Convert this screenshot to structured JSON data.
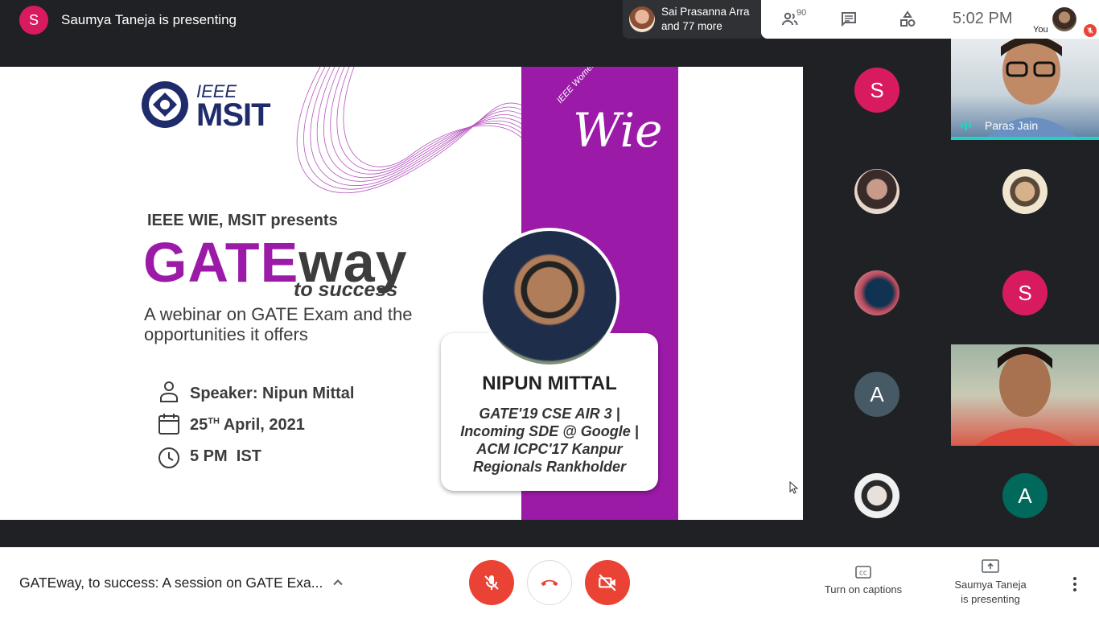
{
  "topbar": {
    "presenter_initial": "S",
    "presenting_text": "Saumya Taneja is presenting"
  },
  "join_notice": {
    "line1": "Sai Prasanna Arra",
    "line2": "and 77 more"
  },
  "info_bar": {
    "people_count": "90",
    "time": "5:02 PM",
    "you_label": "You"
  },
  "slide": {
    "logo_ieee": "IEEE",
    "logo_msit": "MSIT",
    "wie_small": "IEEE Women in Engineering",
    "wie_big": "Wie",
    "presents": "IEEE WIE, MSIT presents",
    "gate_part1": "GATE",
    "gate_part2": "way",
    "to_success": "to success",
    "webinar_text": "A webinar on GATE Exam and the opportunities it offers",
    "speaker_label": "Speaker: Nipun Mittal",
    "date_day": "25",
    "date_suffix": "TH",
    "date_rest": " April, 2021",
    "time": "5 PM  IST",
    "speaker_name": "NIPUN MITTAL",
    "speaker_desc": "GATE'19 CSE AIR 3 | Incoming SDE @ Google | ACM ICPC'17 Kanpur Regionals Rankholder"
  },
  "participants": [
    {
      "kind": "initial",
      "initial": "S",
      "color": "#d81b60"
    },
    {
      "kind": "video",
      "name": "Paras Jain",
      "speaking": true
    },
    {
      "kind": "photo",
      "color": "#c89a8a"
    },
    {
      "kind": "photo",
      "color": "#d6b28c"
    },
    {
      "kind": "photo",
      "color": "#b84a5c"
    },
    {
      "kind": "initial",
      "initial": "S",
      "color": "#d81b60"
    },
    {
      "kind": "initial",
      "initial": "A",
      "color": "#455a64"
    },
    {
      "kind": "video",
      "name": ""
    },
    {
      "kind": "photo",
      "color": "#8a8a8a"
    },
    {
      "kind": "initial",
      "initial": "A",
      "color": "#00695c"
    }
  ],
  "controls": {
    "meeting_title": "GATEway, to success: A session on GATE Exa...",
    "captions_label": "Turn on captions",
    "presenting_line1": "Saumya Taneja",
    "presenting_line2": "is presenting"
  }
}
